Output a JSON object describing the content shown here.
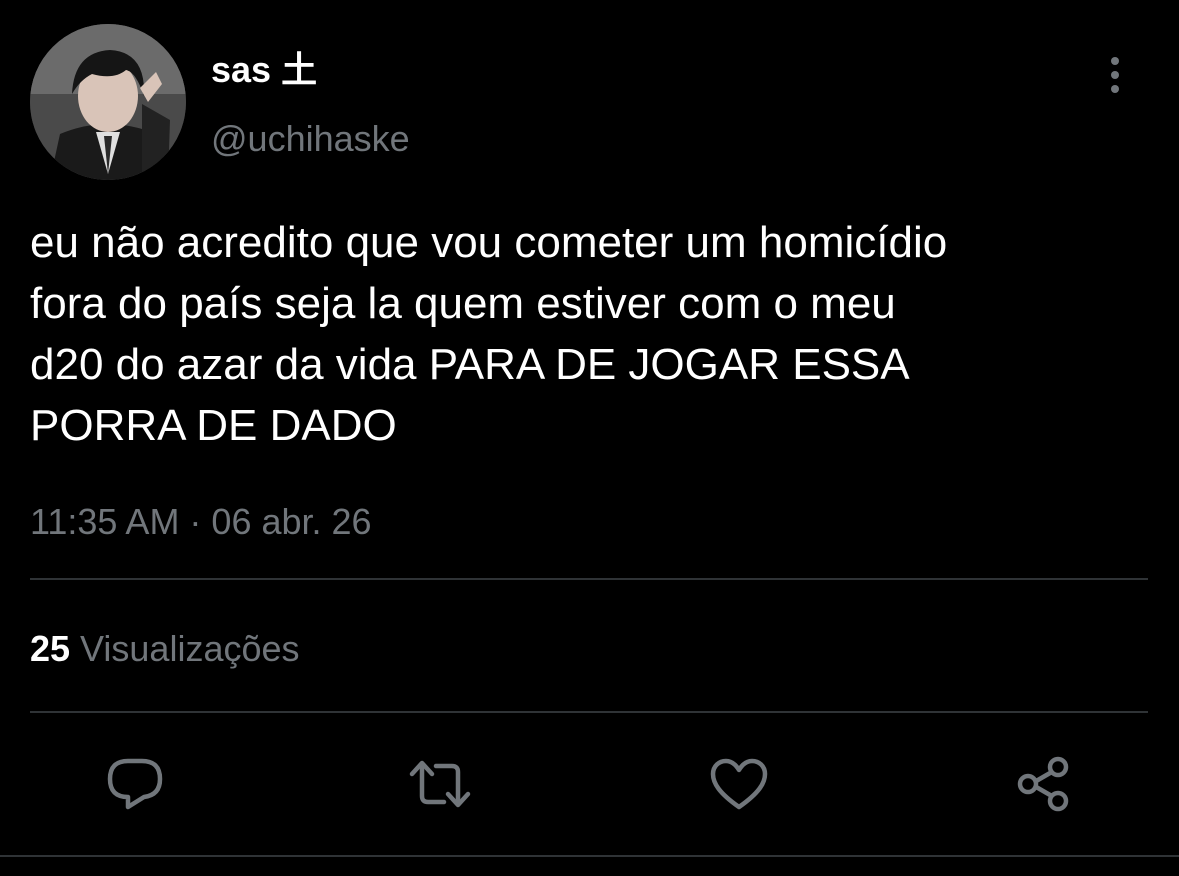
{
  "user": {
    "display_name": "sas 土",
    "handle": "@uchihaske",
    "avatar_icon": "profile-photo"
  },
  "tweet": {
    "text": "eu não acredito que vou cometer um homicídio\nfora do país seja la quem estiver com o meu\nd20 do azar da vida PARA DE JOGAR ESSA\nPORRA DE DADO",
    "timestamp": "11:35 AM · 06 abr. 26"
  },
  "stats": {
    "views_count": "25",
    "views_label": "Visualizações"
  },
  "actions": {
    "reply_icon": "reply-icon",
    "retweet_icon": "retweet-icon",
    "like_icon": "heart-icon",
    "share_icon": "share-icon",
    "more_icon": "more-vertical-icon"
  },
  "colors": {
    "background": "#000000",
    "text_primary": "#ffffff",
    "text_secondary": "#71767b",
    "divider": "#2f3336"
  }
}
